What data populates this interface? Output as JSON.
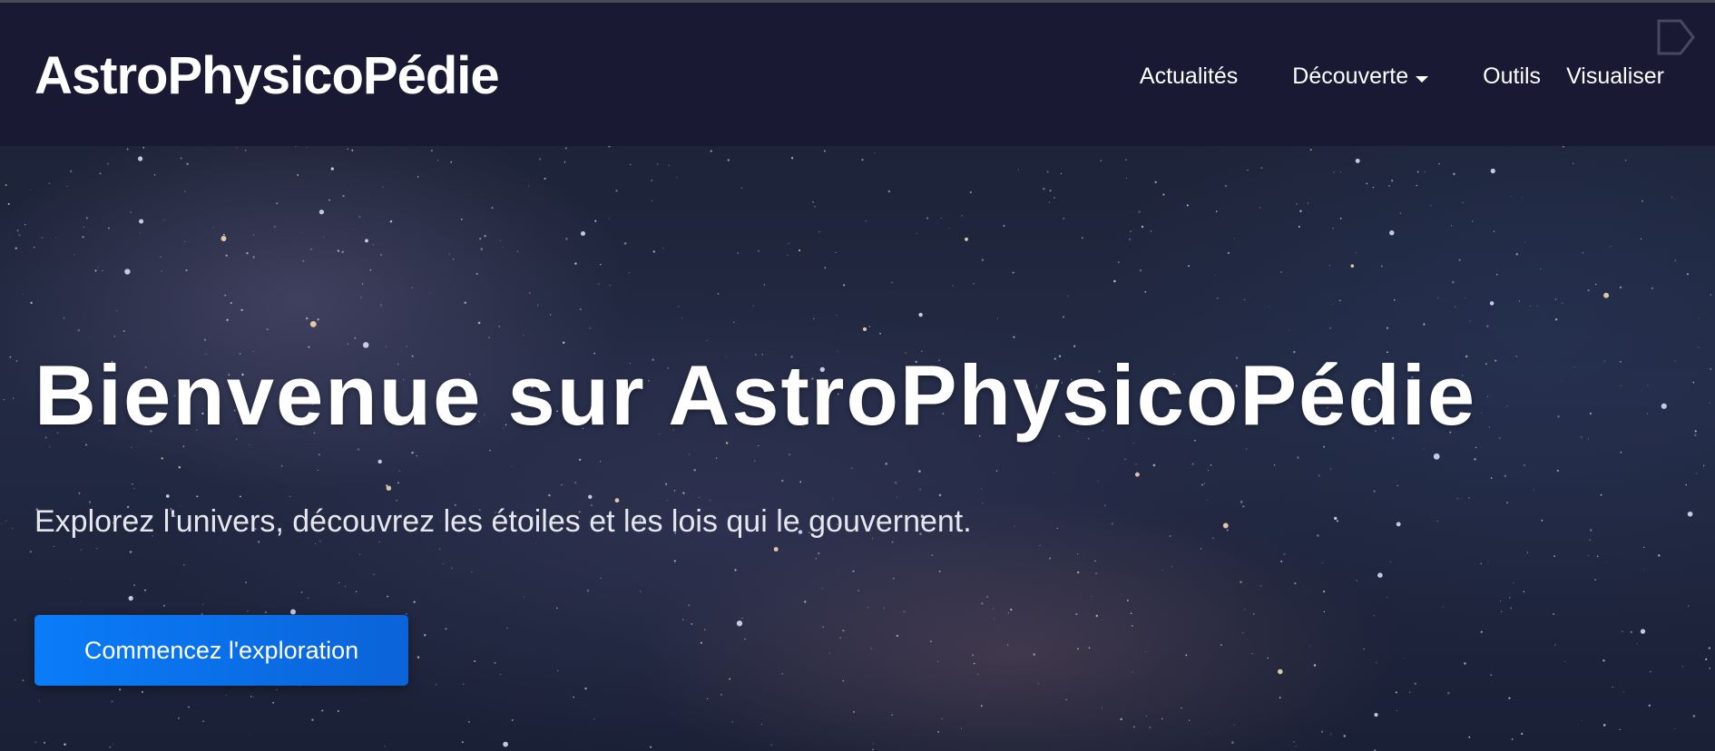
{
  "header": {
    "brand": "AstroPhysicoPédie",
    "nav": [
      {
        "label": "Actualités",
        "dropdown": false
      },
      {
        "label": "Découverte",
        "dropdown": true
      },
      {
        "label": "Outils",
        "dropdown": false
      },
      {
        "label": "Visualiser",
        "dropdown": false
      }
    ],
    "corner_icon": "exit-icon"
  },
  "hero": {
    "title": "Bienvenue sur AstroPhysicoPédie",
    "subtitle": "Explorez l'univers, découvrez les étoiles et les lois qui le gouvernent.",
    "cta_label": "Commencez l'exploration",
    "background": "starfield-image"
  },
  "colors": {
    "navbar_bg": "#1a1934",
    "cta_bg": "#0a7cf8",
    "text": "#ffffff"
  }
}
